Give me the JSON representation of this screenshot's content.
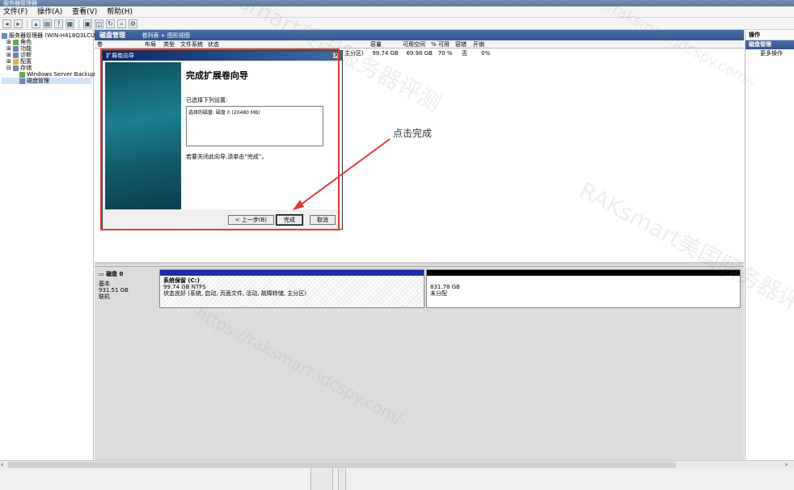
{
  "window": {
    "title": "服务器管理器"
  },
  "menu": [
    "文件(F)",
    "操作(A)",
    "查看(V)",
    "帮助(H)"
  ],
  "tree": {
    "root": "服务器管理器 (WIN-H418Q3LCU8)",
    "items": [
      "角色",
      "功能",
      "诊断",
      "配置",
      "存储",
      "Windows Server Backup",
      "磁盘管理"
    ]
  },
  "header": {
    "title": "磁盘管理",
    "view": "卷列表 + 图形视图"
  },
  "columns": [
    "卷",
    "布局",
    "类型",
    "文件系统",
    "状态",
    "容量",
    "可用空间",
    "% 可用",
    "容错",
    "开销"
  ],
  "row": {
    "status_tail": "主分区)",
    "capacity": "99.74 GB",
    "free": "69.98 GB",
    "pct": "70 %",
    "ft": "否",
    "overhead": "0%"
  },
  "disk": {
    "name": "磁盘 0",
    "type": "基本",
    "size": "931.51 GB",
    "state": "联机",
    "system_vol": {
      "name": "系统保留 (C:)",
      "size": "99.74 GB NTFS",
      "status": "状态良好 (系统, 启动, 页面文件, 活动, 故障转储, 主分区)"
    },
    "unalloc": {
      "size": "831.78 GB",
      "label": "未分配"
    }
  },
  "actions": {
    "head": "操作",
    "sub": "磁盘管理",
    "more": "更多操作"
  },
  "dialog": {
    "title": "扩展卷向导",
    "heading": "完成扩展卷向导",
    "selected_label": "已选择下列设置:",
    "selected_value": "选择的磁盘: 磁盘 0 (20480 MB)",
    "finish_hint": "若要关闭此向导,请单击“完成”。",
    "back": "< 上一步(B)",
    "finish": "完成",
    "cancel": "取消",
    "close": "X"
  },
  "annotation": {
    "text": "点击完成",
    "color": "#e03a3a"
  },
  "watermarks": [
    "RAKsmart美国服务器评测",
    "-https://raksmart.idcspy.com/-"
  ]
}
